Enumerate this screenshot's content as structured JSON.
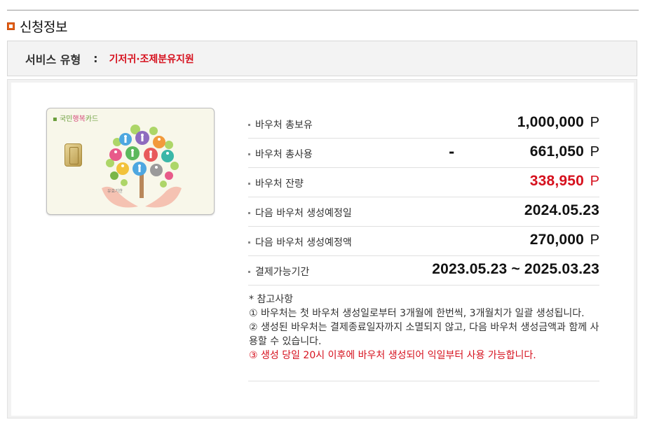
{
  "section": {
    "title": "신청정보"
  },
  "service": {
    "label": "서비스 유형",
    "separator": ":",
    "value": "기저귀·조제분유지원"
  },
  "card": {
    "brand_prefix": "국민",
    "brand_highlight": "행복",
    "brand_suffix": "카드",
    "subtext": "유효기한"
  },
  "voucher": {
    "rows": [
      {
        "label": "바우처 총보유",
        "minus": "",
        "value": "1,000,000",
        "unit": "P"
      },
      {
        "label": "바우처 총사용",
        "minus": "-",
        "value": "661,050",
        "unit": "P"
      },
      {
        "label": "바우처 잔량",
        "minus": "",
        "value": "338,950",
        "unit": "P"
      },
      {
        "label": "다음 바우처 생성예정일",
        "minus": "",
        "value": "2024.05.23",
        "unit": ""
      },
      {
        "label": "다음 바우처 생성예정액",
        "minus": "",
        "value": "270,000",
        "unit": "P"
      },
      {
        "label": "결제가능기간",
        "minus": "",
        "value": "2023.05.23 ~ 2025.03.23",
        "unit": ""
      }
    ]
  },
  "notes": {
    "title": "* 참고사항",
    "line1": "① 바우처는 첫 바우처 생성일로부터 3개월에 한번씩, 3개월치가 일괄 생성됩니다.",
    "line2": "② 생성된 바우처는 결제종료일자까지 소멸되지 않고, 다음 바우처 생성금액과 함께 사용할 수 있습니다.",
    "line3": "③ 생성 당일 20시 이후에 바우처 생성되어 익일부터 사용 가능합니다."
  },
  "colors": {
    "accent": "#d6111e",
    "bullet": "#e35f16",
    "bar_bg": "#f3f3f3"
  }
}
